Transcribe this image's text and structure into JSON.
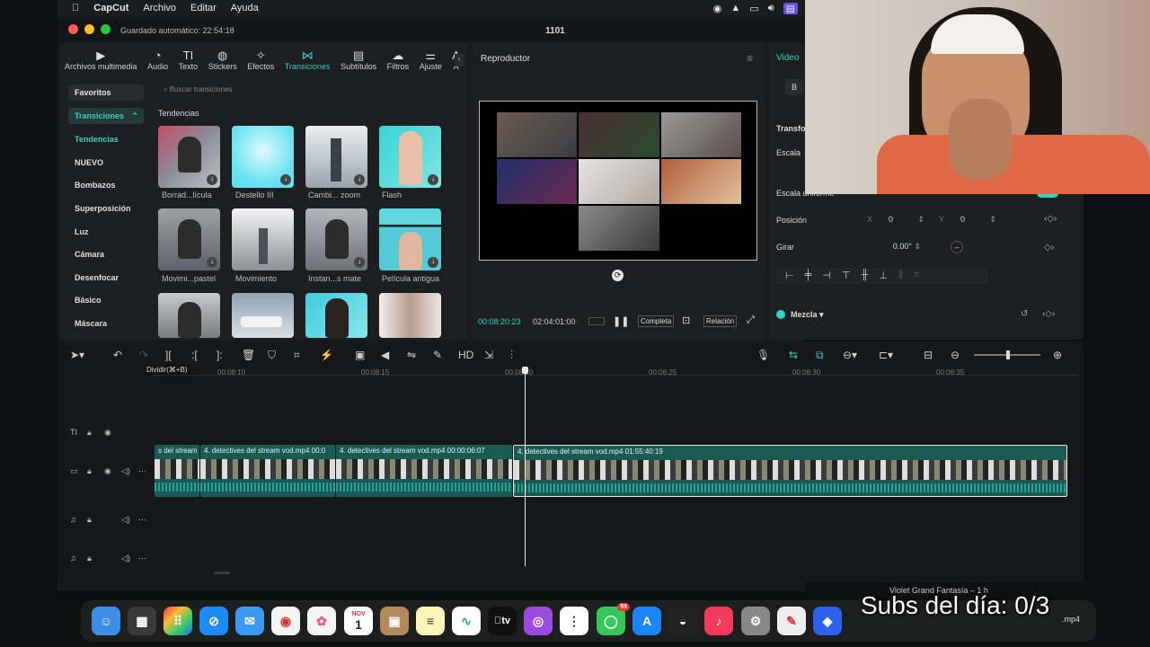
{
  "menubar": {
    "app_name": "CapCut",
    "items": [
      "Archivo",
      "Editar",
      "Ayuda"
    ]
  },
  "window": {
    "autosave": "Guardado automático: 22:54:18",
    "project_title": "1101"
  },
  "toolbar": {
    "items": [
      {
        "label": "Archivos multimedia",
        "icon": "media-icon"
      },
      {
        "label": "Audio",
        "icon": "audio-icon"
      },
      {
        "label": "Texto",
        "icon": "text-icon"
      },
      {
        "label": "Stickers",
        "icon": "sticker-icon"
      },
      {
        "label": "Efectos",
        "icon": "effects-icon"
      },
      {
        "label": "Transiciones",
        "icon": "transitions-icon"
      },
      {
        "label": "Subtítulos",
        "icon": "subtitles-icon"
      },
      {
        "label": "Filtros",
        "icon": "filters-icon"
      },
      {
        "label": "Ajuste",
        "icon": "adjust-icon"
      },
      {
        "label": "A",
        "icon": "more-icon"
      }
    ],
    "active": "Transiciones"
  },
  "sidebar": {
    "favorites": "Favoritos",
    "group": "Transiciones",
    "items": [
      "Tendencias",
      "NUEVO",
      "Bombazos",
      "Superposición",
      "Luz",
      "Cámara",
      "Desenfocar",
      "Básico",
      "Máscara"
    ],
    "active": "Tendencias"
  },
  "search": {
    "placeholder": "Buscar transiciones"
  },
  "section_title": "Tendencias",
  "transitions": [
    {
      "label": "Borrad...lícula"
    },
    {
      "label": "Destello III"
    },
    {
      "label": "Cambi... zoom"
    },
    {
      "label": "Flash"
    },
    {
      "label": "Movimi...pastel"
    },
    {
      "label": "Movimiento"
    },
    {
      "label": "Instan...s mate"
    },
    {
      "label": "Película antigua"
    },
    {
      "label": ""
    },
    {
      "label": ""
    },
    {
      "label": ""
    },
    {
      "label": ""
    }
  ],
  "player": {
    "title": "Reproductor",
    "current_time": "00:08:20:23",
    "total_time": "02:04:01:00",
    "btn_full": "Completa",
    "btn_ratio": "Relación"
  },
  "inspector": {
    "tab": "Video",
    "section_b": "B",
    "transform": "Transfor",
    "scale": "Escala",
    "uniform_scale": "Escala uniforme",
    "position_label": "Posición",
    "pos_x_label": "X",
    "pos_x_value": "0",
    "pos_y_label": "Y",
    "pos_y_value": "0",
    "rotate_label": "Girar",
    "rotate_value": "0.00°",
    "blend_label": "Mezcla"
  },
  "timeline": {
    "tooltip": "Dividir(⌘+B)",
    "ticks": [
      "00:08:10",
      "00:08:15",
      "00:08:20",
      "00:08:25",
      "00:08:30",
      "00:08:35"
    ],
    "clips": [
      {
        "title": "s del stream v"
      },
      {
        "title": "4. detectives del stream vod.mp4  00:0"
      },
      {
        "title": "4. detectives del stream vod.mp4  00:00:06:07"
      },
      {
        "title": "4. detectives del stream vod.mp4  01:55:40:19"
      }
    ]
  },
  "dock": {
    "calendar_month": "NOV",
    "calendar_day": "1",
    "appletv_label": "tv",
    "badge": "59",
    "now_playing": "Violet Grand Fantasía – 1 h",
    "file_label": ".mp4"
  },
  "overlay": {
    "text": "Subs del día: 0/3"
  },
  "colors": {
    "accent": "#35d1c4",
    "clip": "#195a54",
    "panel": "#1d1e20"
  }
}
